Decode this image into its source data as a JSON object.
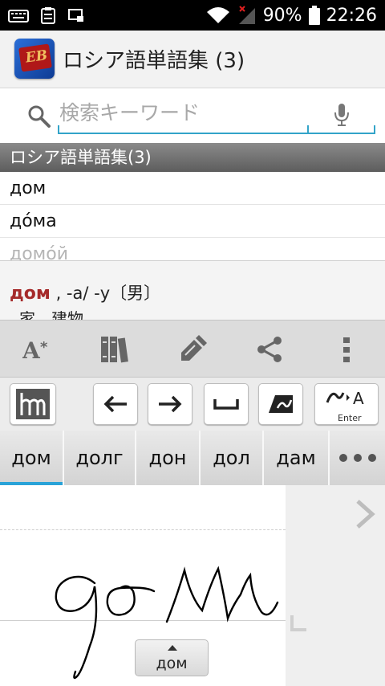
{
  "status_bar": {
    "battery": "90%",
    "time": "22:26"
  },
  "app_bar": {
    "title": "ロシア語単語集 (3)"
  },
  "search": {
    "placeholder": "検索キーワード"
  },
  "section_header": "ロシア語単語集(3)",
  "word_list": [
    {
      "word": "дом"
    },
    {
      "word": "до́ма"
    },
    {
      "word": "домо́й"
    }
  ],
  "definition": {
    "headword": "дом",
    "forms": ", -а/ -у〔男〕",
    "meaning": "家、建物。"
  },
  "keyboard": {
    "enter_label": "Enter",
    "candidates": [
      "дом",
      "долг",
      "дон",
      "дол",
      "дам"
    ],
    "selected_candidate": 0,
    "preview_label": "дом"
  },
  "colors": {
    "accent": "#2aa3d8",
    "headword": "#a52a2a"
  }
}
